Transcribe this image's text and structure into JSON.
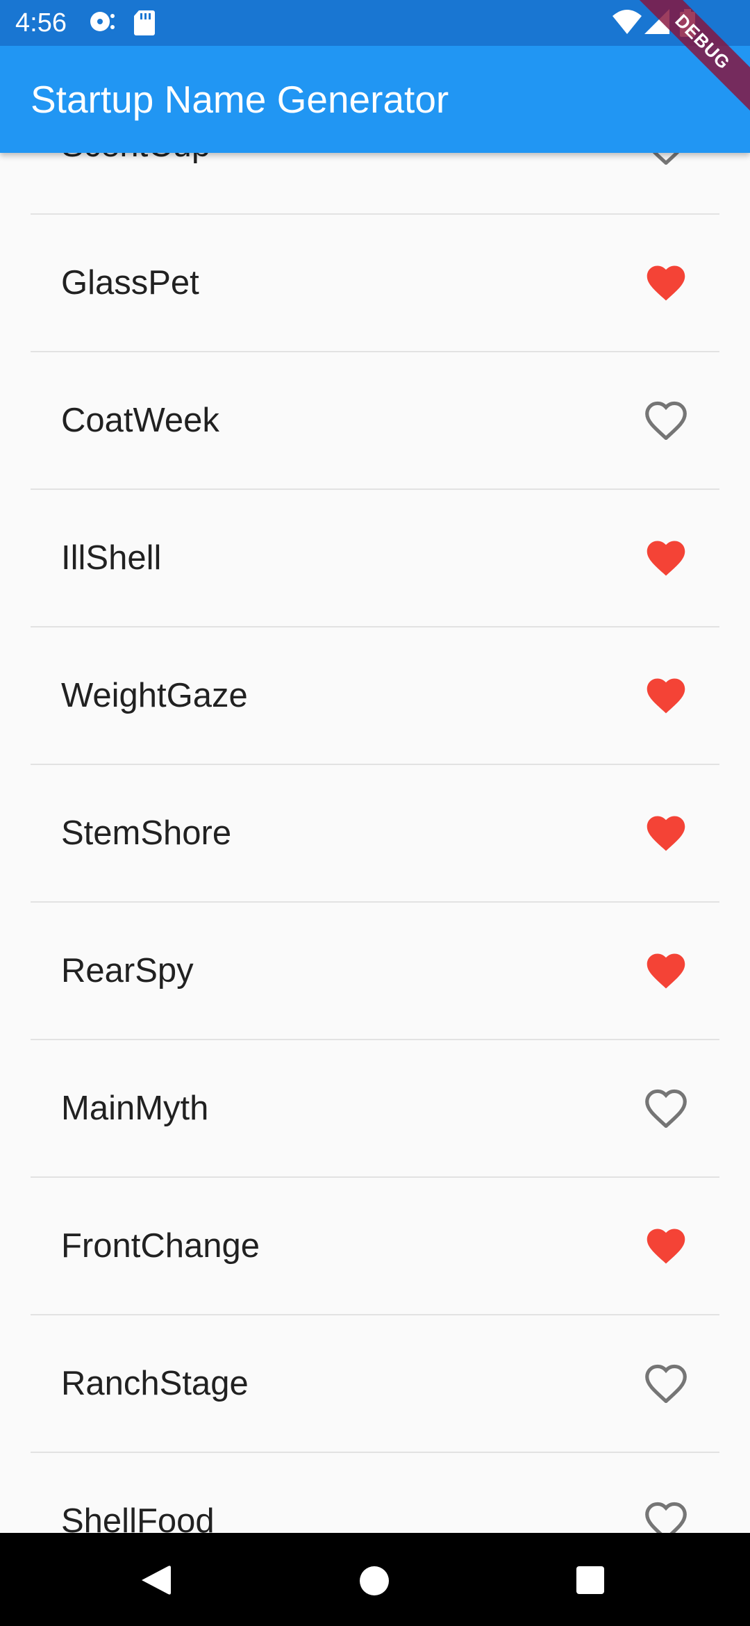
{
  "status_bar": {
    "time": "4:56",
    "icons": [
      "media-icon",
      "sd-card-icon",
      "wifi-icon",
      "signal-icon",
      "battery-icon"
    ]
  },
  "app_bar": {
    "title": "Startup Name Generator",
    "color": "#2196f3"
  },
  "debug_banner": {
    "label": "DEBUG"
  },
  "list": {
    "items": [
      {
        "name": "ScentCup",
        "favorited": false
      },
      {
        "name": "GlassPet",
        "favorited": true
      },
      {
        "name": "CoatWeek",
        "favorited": false
      },
      {
        "name": "IllShell",
        "favorited": true
      },
      {
        "name": "WeightGaze",
        "favorited": true
      },
      {
        "name": "StemShore",
        "favorited": true
      },
      {
        "name": "RearSpy",
        "favorited": true
      },
      {
        "name": "MainMyth",
        "favorited": false
      },
      {
        "name": "FrontChange",
        "favorited": true
      },
      {
        "name": "RanchStage",
        "favorited": false
      },
      {
        "name": "ShellFood",
        "favorited": false
      }
    ],
    "favorite_color": "#f44336",
    "unfavorite_color": "#757575"
  },
  "nav_bar": {
    "buttons": [
      "back-icon",
      "home-icon",
      "recents-icon"
    ]
  }
}
